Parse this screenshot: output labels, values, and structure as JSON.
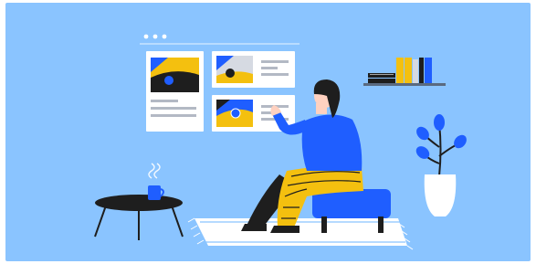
{
  "image": {
    "palette": {
      "background": "#8ac4ff",
      "panel_white": "#ffffff",
      "blue": "#1f5eff",
      "yellow": "#f4c00f",
      "dark": "#1e1e1e",
      "grey": "#b3b9c4",
      "line_grey": "#d6dae2"
    },
    "scene_elements": [
      "window-dots",
      "wall-shelf-line",
      "photo-card-landscape",
      "photo-card-image-small",
      "photo-card-image-blue",
      "bookshelf-with-binders",
      "person-sitting-on-stool",
      "plant-in-white-vase",
      "coffee-table-with-mug",
      "steam-icon",
      "striped-rug"
    ]
  }
}
